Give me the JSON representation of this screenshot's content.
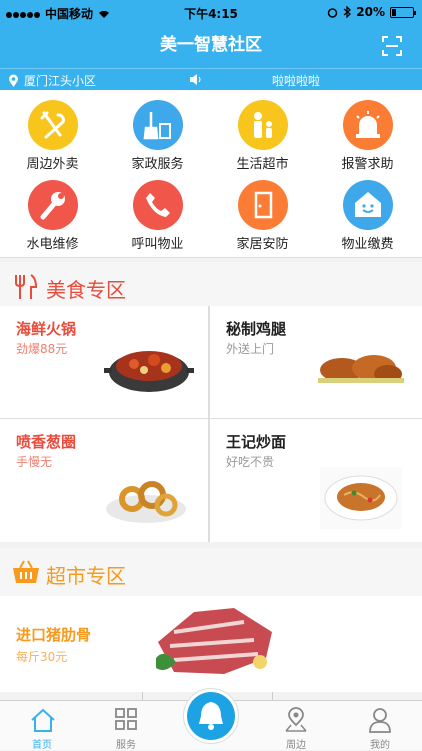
{
  "status_bar": {
    "carrier": "中国移动",
    "time": "下午4:15",
    "battery": "20%"
  },
  "header": {
    "title": "美一智慧社区"
  },
  "location": {
    "name": "厦门江头小区",
    "announcement": "啦啦啦啦"
  },
  "services": [
    {
      "label": "周边外卖",
      "color": "#f8c51c",
      "icon": "utensils-icon"
    },
    {
      "label": "家政服务",
      "color": "#3ea8ea",
      "icon": "broom-icon"
    },
    {
      "label": "生活超市",
      "color": "#f8c51c",
      "icon": "family-icon"
    },
    {
      "label": "报警求助",
      "color": "#fb7c35",
      "icon": "alarm-icon"
    },
    {
      "label": "水电维修",
      "color": "#f0574a",
      "icon": "wrench-icon"
    },
    {
      "label": "呼叫物业",
      "color": "#f0574a",
      "icon": "phone-icon"
    },
    {
      "label": "家居安防",
      "color": "#fb7c35",
      "icon": "door-icon"
    },
    {
      "label": "物业缴费",
      "color": "#3ea8ea",
      "icon": "house-face-icon"
    }
  ],
  "food_section": {
    "title": "美食专区",
    "color": "#e84c3d",
    "items": [
      {
        "name": "海鲜火锅",
        "sub": "劲爆88元"
      },
      {
        "name": "秘制鸡腿",
        "sub": "外送上门"
      },
      {
        "name": "喷香葱圈",
        "sub": "手慢无"
      },
      {
        "name": "王记炒面",
        "sub": "好吃不贵"
      }
    ]
  },
  "market_section": {
    "title": "超市专区",
    "color": "#f79a1e",
    "items": [
      {
        "name": "进口猪肋骨",
        "sub": "每斤30元"
      }
    ]
  },
  "tabbar": {
    "items": [
      {
        "label": "首页",
        "active": true
      },
      {
        "label": "服务",
        "active": false
      },
      {
        "label": "周边",
        "active": false
      },
      {
        "label": "我的",
        "active": false
      }
    ]
  }
}
